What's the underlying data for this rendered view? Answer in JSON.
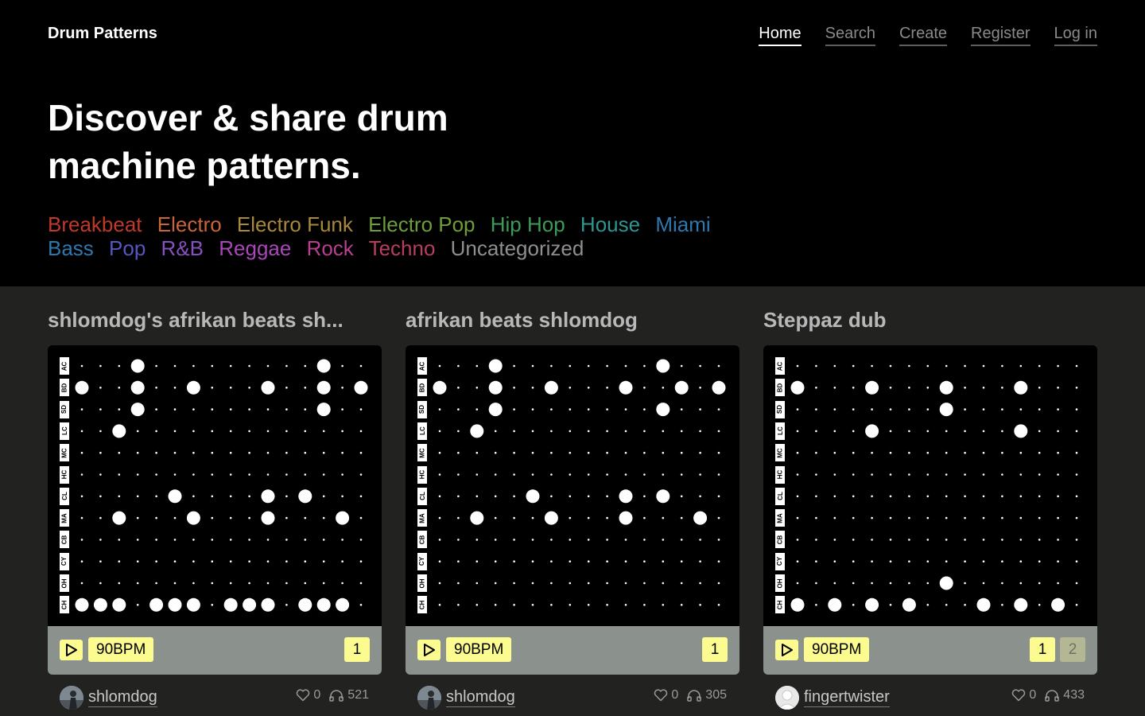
{
  "brand": "Drum Patterns",
  "nav": [
    {
      "label": "Home",
      "active": true
    },
    {
      "label": "Search",
      "active": false
    },
    {
      "label": "Create",
      "active": false
    },
    {
      "label": "Register",
      "active": false
    },
    {
      "label": "Log in",
      "active": false
    }
  ],
  "hero": {
    "line1": "Discover & share drum",
    "line2": "machine patterns."
  },
  "genres": [
    {
      "label": "Breakbeat",
      "color": "#c0392b"
    },
    {
      "label": "Electro",
      "color": "#c8653a"
    },
    {
      "label": "Electro Funk",
      "color": "#a8893b"
    },
    {
      "label": "Electro Pop",
      "color": "#6e9e3a"
    },
    {
      "label": "Hip Hop",
      "color": "#3d9b58"
    },
    {
      "label": "House",
      "color": "#2f9591"
    },
    {
      "label": "Miami Bass",
      "color": "#2f78ad"
    },
    {
      "label": "Pop",
      "color": "#5656c2"
    },
    {
      "label": "R&B",
      "color": "#8750c0"
    },
    {
      "label": "Reggae",
      "color": "#a848b8"
    },
    {
      "label": "Rock",
      "color": "#b8408f"
    },
    {
      "label": "Techno",
      "color": "#b83e5f"
    },
    {
      "label": "Uncategorized",
      "color": "#8f8f8f"
    }
  ],
  "instruments": [
    "AC",
    "BD",
    "SD",
    "LC",
    "MC",
    "HC",
    "CL",
    "MA",
    "CB",
    "CY",
    "OH",
    "CH"
  ],
  "cards": [
    {
      "title": "shlomdog's afrikan beats sh...",
      "bpm": "90BPM",
      "pages": [
        {
          "label": "1",
          "active": true
        }
      ],
      "user": "shlomdog",
      "likes": "0",
      "plays": "521",
      "avatar": "photo",
      "pattern": [
        [
          3,
          13
        ],
        [
          0,
          3,
          6,
          10,
          13,
          15
        ],
        [
          3,
          13
        ],
        [
          2
        ],
        [],
        [],
        [
          5,
          10,
          12
        ],
        [
          2,
          6,
          10,
          14
        ],
        [],
        [],
        [],
        [
          0,
          1,
          2,
          4,
          5,
          6,
          8,
          9,
          10,
          12,
          13,
          14
        ]
      ]
    },
    {
      "title": "afrikan beats shlomdog",
      "bpm": "90BPM",
      "pages": [
        {
          "label": "1",
          "active": true
        }
      ],
      "user": "shlomdog",
      "likes": "0",
      "plays": "305",
      "avatar": "photo",
      "pattern": [
        [
          3,
          12
        ],
        [
          0,
          3,
          6,
          10,
          13,
          15
        ],
        [
          3,
          12
        ],
        [
          2
        ],
        [],
        [],
        [
          5,
          10,
          12
        ],
        [
          2,
          6,
          10,
          14
        ],
        [],
        [],
        [],
        []
      ]
    },
    {
      "title": "Steppaz dub",
      "bpm": "90BPM",
      "pages": [
        {
          "label": "1",
          "active": true
        },
        {
          "label": "2",
          "active": false
        }
      ],
      "user": "fingertwister",
      "likes": "0",
      "plays": "433",
      "avatar": "default",
      "pattern": [
        [],
        [
          0,
          4,
          8,
          12
        ],
        [
          8
        ],
        [
          4,
          12
        ],
        [],
        [],
        [],
        [],
        [],
        [],
        [
          8
        ],
        [
          0,
          2,
          4,
          6,
          10,
          12,
          14
        ]
      ]
    }
  ]
}
